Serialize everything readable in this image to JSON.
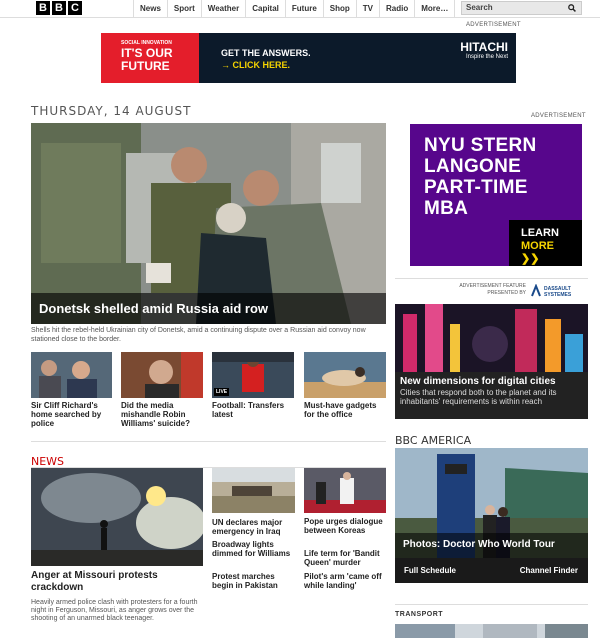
{
  "header": {
    "logo_letters": [
      "B",
      "B",
      "C"
    ],
    "nav_items": [
      "News",
      "Sport",
      "Weather",
      "Capital",
      "Future",
      "Shop",
      "TV",
      "Radio",
      "More…"
    ],
    "search_label": "Search"
  },
  "ad_label_top": "ADVERTISEMENT",
  "top_banner": {
    "kicker": "SOCIAL INNOVATION",
    "headline": "IT'S OUR FUTURE",
    "cta_line1": "GET THE ANSWERS.",
    "cta_line2": "→ CLICK HERE.",
    "brand": "HITACHI",
    "tagline": "Inspire the Next"
  },
  "date_heading": "THURSDAY, 14 AUGUST",
  "hero": {
    "title": "Donetsk shelled amid Russia aid row",
    "summary": "Shells hit the rebel-held Ukrainian city of Donetsk, amid a continuing dispute over a Russian aid convoy now stationed close to the border."
  },
  "stories": [
    {
      "caption": "Sir Cliff Richard's home searched by police"
    },
    {
      "caption": "Did the media mishandle Robin Williams' suicide?"
    },
    {
      "caption": "Football: Transfers latest",
      "badge": "LIVE"
    },
    {
      "caption": "Must-have gadgets for the office"
    }
  ],
  "news": {
    "label": "NEWS",
    "hero_title": "Anger at Missouri protests crackdown",
    "hero_summary": "Heavily armed police clash with protesters for a fourth night in Ferguson, Missouri, as anger grows over the shooting of an unarmed black teenager.",
    "col1": [
      "UN declares major emergency in Iraq",
      "Broadway lights dimmed for Williams",
      "Protest marches begin in Pakistan"
    ],
    "col2": [
      "Pope urges dialogue between Koreas",
      "Life term for 'Bandit Queen' murder",
      "Pilot's arm 'came off while landing'"
    ]
  },
  "right": {
    "ad_label": "ADVERTISEMENT",
    "nyu_lines": [
      "NYU STERN",
      "LANGONE",
      "PART-TIME",
      "MBA"
    ],
    "nyu_cta_lines": [
      "LEARN",
      "MORE ❯❯"
    ],
    "feature_label_line1": "ADVERTISEMENT FEATURE",
    "feature_label_line2": "PRESENTED BY",
    "feature_brand_line1": "DASSAULT",
    "feature_brand_line2": "SYSTEMES",
    "feature_title": "New dimensions for digital cities",
    "feature_summary": "Cities that respond both to the planet and its inhabitants' requirements is within reach",
    "bbc_america": "BBC AMERICA",
    "dw_title": "Photos: Doctor Who World Tour",
    "dw_left_link": "Full Schedule",
    "dw_right_link": "Channel Finder",
    "transport": "TRANSPORT"
  }
}
